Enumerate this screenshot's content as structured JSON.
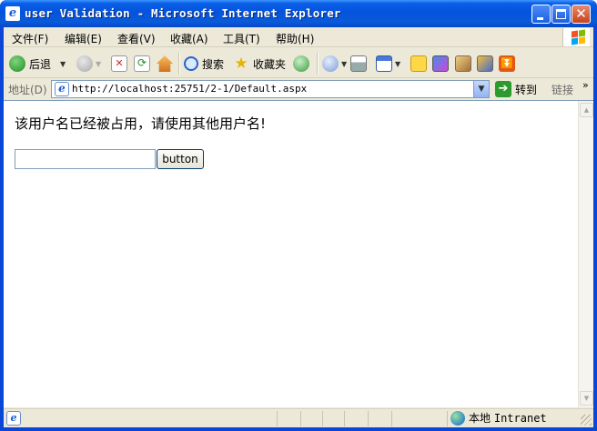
{
  "window": {
    "title": "user Validation - Microsoft Internet Explorer"
  },
  "menu": {
    "items": [
      "文件(F)",
      "编辑(E)",
      "查看(V)",
      "收藏(A)",
      "工具(T)",
      "帮助(H)"
    ]
  },
  "toolbar": {
    "back_label": "后退",
    "search_label": "搜索",
    "favorites_label": "收藏夹",
    "icons": [
      "back-icon",
      "forward-icon",
      "stop-icon",
      "refresh-icon",
      "home-icon",
      "search-icon",
      "favorites-icon",
      "history-icon",
      "mail-icon",
      "print-icon",
      "edit-icon",
      "discuss-icon",
      "messenger-icon",
      "research-icon",
      "tools-icon",
      "addon-icon"
    ]
  },
  "address": {
    "label": "地址(D)",
    "url": "http://localhost:25751/2-1/Default.aspx",
    "go_label": "转到",
    "links_label": "链接",
    "links_more": "»"
  },
  "page": {
    "message": "该用户名已经被占用，请使用其他用户名!",
    "input_value": "",
    "button_label": "button"
  },
  "status": {
    "zone_prefix": "本地",
    "zone_name": "Intranet"
  },
  "colors": {
    "titlebar": "#0553dc",
    "chrome": "#ece9d8",
    "go_green": "#2c9a2c"
  }
}
